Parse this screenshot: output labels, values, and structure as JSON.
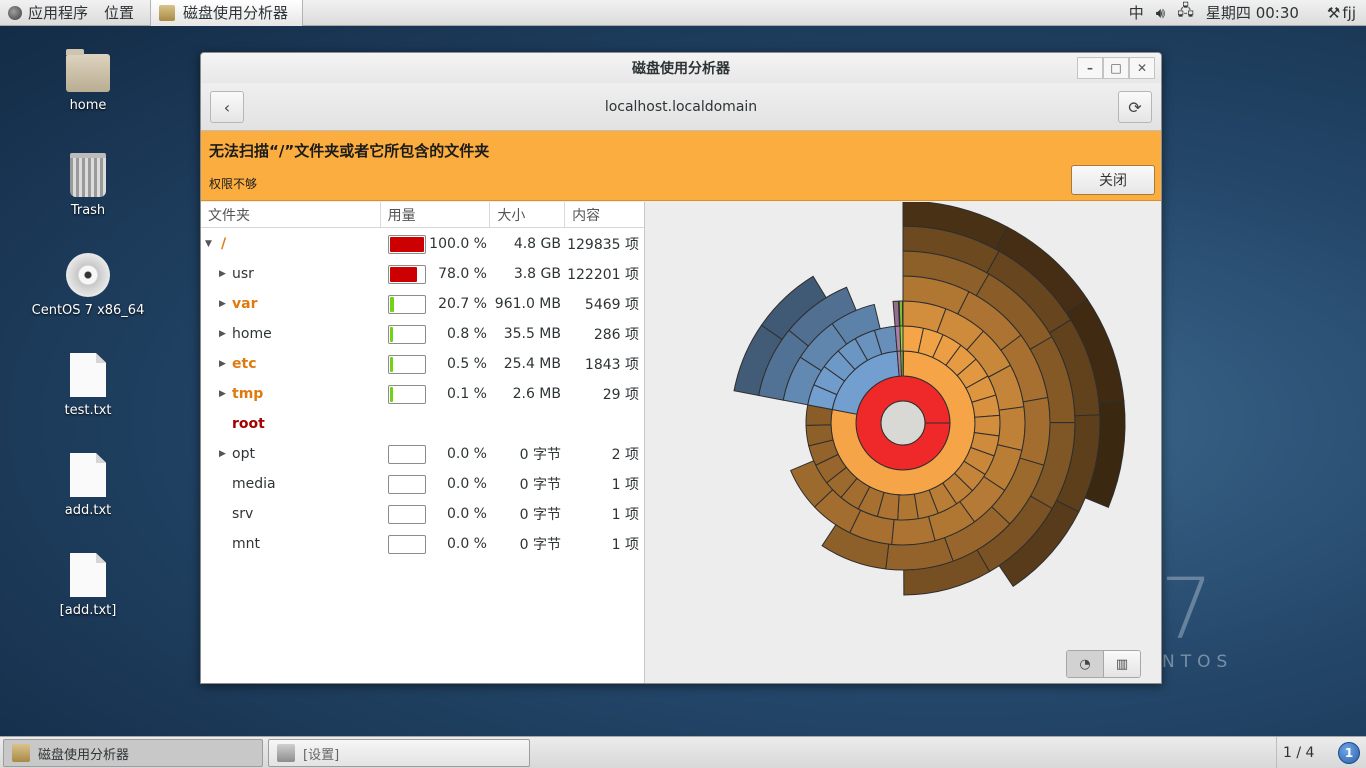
{
  "top_panel": {
    "applications": "应用程序",
    "places": "位置",
    "active_app": "磁盘使用分析器",
    "input_method": "中",
    "volume_icon": "speaker-icon",
    "network_icon": "network-wired-icon",
    "clock": "星期四 00:30",
    "user_icon": "user-menu-icon",
    "user": "fjj"
  },
  "desktop": {
    "icons": [
      {
        "label": "home",
        "icon": "home-folder-icon"
      },
      {
        "label": "Trash",
        "icon": "trash-icon"
      },
      {
        "label": "CentOS 7 x86_64",
        "icon": "dvd-icon"
      },
      {
        "label": "test.txt",
        "icon": "text-file-icon"
      },
      {
        "label": "add.txt",
        "icon": "text-file-icon"
      },
      {
        "label": "[add.txt]",
        "icon": "text-file-icon"
      }
    ],
    "watermark_number": "7",
    "watermark_word": "NTOS"
  },
  "window": {
    "title": "磁盘使用分析器",
    "location": "localhost.localdomain",
    "infobar": {
      "title": "无法扫描“/”文件夹或者它所包含的文件夹",
      "subtitle": "权限不够",
      "close_label": "关闭",
      "bg_color": "#fbad3f"
    },
    "columns": {
      "folder": "文件夹",
      "usage": "用量",
      "size": "大小",
      "contents": "内容"
    },
    "rows": [
      {
        "name": "/",
        "expander": "expanded",
        "name_color": "#e07a10",
        "usage": 100.0,
        "usage_color": "#cc0000",
        "pct": "100.0 %",
        "size": "4.8 GB",
        "count": "129835 项"
      },
      {
        "name": "usr",
        "expander": "collapsed",
        "name_color": "#2e3436",
        "usage": 78.0,
        "usage_color": "#cc0000",
        "pct": "78.0 %",
        "size": "3.8 GB",
        "count": "122201 项"
      },
      {
        "name": "var",
        "expander": "collapsed",
        "name_color": "#e07a10",
        "usage": 20.7,
        "usage_color": "#73d216",
        "pct": "20.7 %",
        "size": "961.0 MB",
        "count": "5469 项"
      },
      {
        "name": "home",
        "expander": "collapsed",
        "name_color": "#2e3436",
        "usage": 0.8,
        "usage_color": "#73d216",
        "pct": "0.8 %",
        "size": "35.5 MB",
        "count": "286 项"
      },
      {
        "name": "etc",
        "expander": "collapsed",
        "name_color": "#e07a10",
        "usage": 0.5,
        "usage_color": "#73d216",
        "pct": "0.5 %",
        "size": "25.4 MB",
        "count": "1843 项"
      },
      {
        "name": "tmp",
        "expander": "collapsed",
        "name_color": "#e07a10",
        "usage": 0.1,
        "usage_color": "#73d216",
        "pct": "0.1 %",
        "size": "2.6 MB",
        "count": "29 项"
      },
      {
        "name": "root",
        "expander": "none",
        "name_color": "#a40000",
        "usage": null,
        "usage_color": "",
        "pct": "",
        "size": "",
        "count": ""
      },
      {
        "name": "opt",
        "expander": "collapsed",
        "name_color": "#2e3436",
        "usage": 0.0,
        "usage_color": "#73d216",
        "pct": "0.0 %",
        "size": "0 字节",
        "count": "2 项"
      },
      {
        "name": "media",
        "expander": "none",
        "name_color": "#2e3436",
        "usage": 0.0,
        "usage_color": "#73d216",
        "pct": "0.0 %",
        "size": "0 字节",
        "count": "1 项"
      },
      {
        "name": "srv",
        "expander": "none",
        "name_color": "#2e3436",
        "usage": 0.0,
        "usage_color": "#73d216",
        "pct": "0.0 %",
        "size": "0 字节",
        "count": "1 项"
      },
      {
        "name": "mnt",
        "expander": "none",
        "name_color": "#2e3436",
        "usage": 0.0,
        "usage_color": "#73d216",
        "pct": "0.0 %",
        "size": "0 字节",
        "count": "1 项"
      }
    ],
    "chart_switch": {
      "ring_icon": "ring-chart-icon",
      "treemap_icon": "treemap-icon"
    }
  },
  "bottom_panel": {
    "tasks": [
      {
        "label": "磁盘使用分析器",
        "state": "active",
        "icon": "disk-analyzer-icon"
      },
      {
        "label": "[设置]",
        "state": "inactive",
        "icon": "settings-tools-icon"
      }
    ],
    "workspace": "1 / 4",
    "notifications": "1"
  },
  "chart_data": {
    "type": "sunburst",
    "root": {
      "name": "/",
      "share": 100.0,
      "color": "#ef2929"
    },
    "level1": [
      {
        "name": "usr",
        "share": 78.0,
        "color": "#f5a547"
      },
      {
        "name": "var",
        "share": 20.7,
        "color": "#729fcf"
      },
      {
        "name": "home",
        "share": 0.8,
        "color": "#ad7fa8"
      },
      {
        "name": "etc",
        "share": 0.5,
        "color": "#8ae234"
      },
      {
        "name": "tmp",
        "share": 0.1,
        "color": "#c4a000"
      }
    ]
  }
}
